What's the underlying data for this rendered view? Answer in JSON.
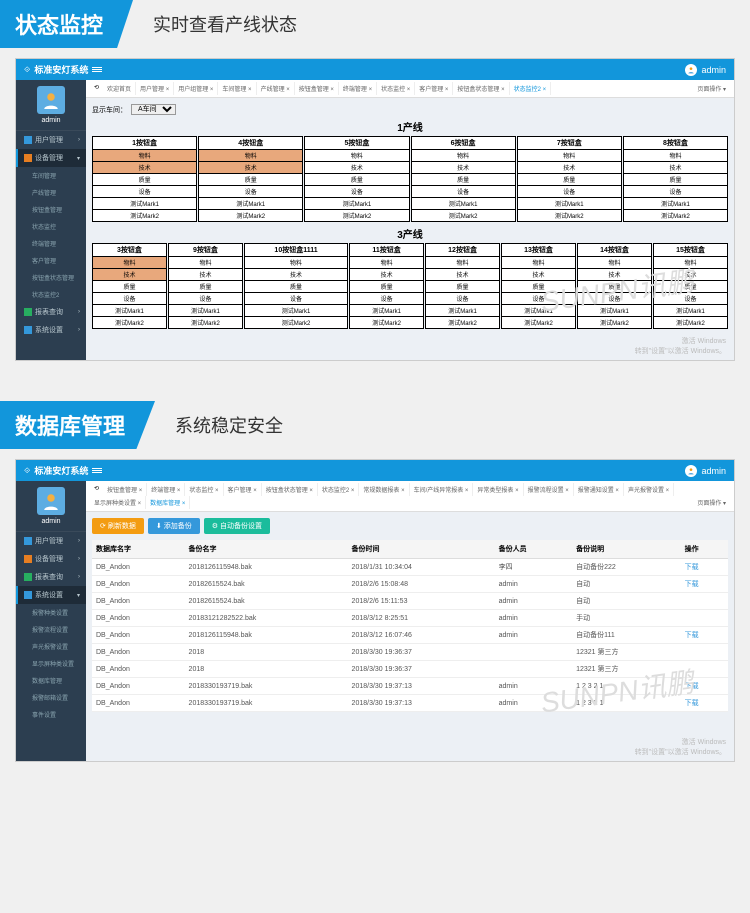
{
  "section1": {
    "banner": "状态监控",
    "subtitle": "实时查看产线状态"
  },
  "section2": {
    "banner": "数据库管理",
    "subtitle": "系统稳定安全"
  },
  "app": {
    "title": "标准安灯系统",
    "user": "admin",
    "admin_label": "admin"
  },
  "nav1": {
    "user_mgmt": "用户管理",
    "dev_mgmt": "设备管理",
    "workshop": "车间管理",
    "line": "产线管理",
    "button": "按钮盒管理",
    "status": "状态监控",
    "remote": "终端管理",
    "client": "客户管理",
    "btn_status": "按钮盒状态管理",
    "status2": "状态监控2",
    "report": "报表查询",
    "sys": "系统设置"
  },
  "nav2": {
    "user_mgmt": "用户管理",
    "dev_mgmt": "设备管理",
    "report": "报表查询",
    "sys": "系统设置",
    "s1": "报警种类设置",
    "s2": "报警流程设置",
    "s3": "声光报警设置",
    "s4": "显示屏种类设置",
    "s5": "数据库管理",
    "s6": "报警邮箱设置",
    "s7": "事件设置"
  },
  "tabs1": [
    "欢迎首页",
    "用户管理 ×",
    "用户组管理 ×",
    "车间管理 ×",
    "产线管理 ×",
    "按钮盒管理 ×",
    "终端管理 ×",
    "状态监控 ×",
    "客户管理 ×",
    "按钮盒状态管理 ×",
    "状态监控2 ×"
  ],
  "tabs2": [
    "按钮盒管理 ×",
    "终端管理 ×",
    "状态监控 ×",
    "客户管理 ×",
    "按钮盒状态管理 ×",
    "状态监控2 ×",
    "常规数据报表 ×",
    "车间/产线异常报表 ×",
    "异常类型报表 ×",
    "报警流程设置 ×",
    "报警通知设置 ×",
    "声光报警设置 ×",
    "显示屏种类设置 ×",
    "数据库管理 ×"
  ],
  "tab_ops": "页面操作 ▾",
  "filter_label": "显示车间：",
  "filter_value": "A车间",
  "line1_title": "1产线",
  "line3_title": "3产线",
  "grid1_headers": [
    "1按钮盒",
    "4按钮盒",
    "5按钮盒",
    "6按钮盒",
    "7按钮盒",
    "8按钮盒"
  ],
  "grid3_headers": [
    "3按钮盒",
    "9按钮盒",
    "10按钮盒1111",
    "11按钮盒",
    "12按钮盒",
    "13按钮盒",
    "14按钮盒",
    "15按钮盒"
  ],
  "grid_rows": [
    "物料",
    "技术",
    "质量",
    "设备",
    "测试Mark1",
    "测试Mark2"
  ],
  "btns": {
    "refresh": "刷新数据",
    "add": "添加备份",
    "auto": "自动备份设置"
  },
  "table": {
    "headers": [
      "数据库名字",
      "备份名字",
      "备份时间",
      "备份人员",
      "备份说明",
      "操作"
    ],
    "rows": [
      [
        "DB_Andon",
        "2018126115948.bak",
        "2018/1/31 10:34:04",
        "李四",
        "自动备份222",
        "下载"
      ],
      [
        "DB_Andon",
        "20182615524.bak",
        "2018/2/6 15:08:48",
        "admin",
        "自动",
        "下载"
      ],
      [
        "DB_Andon",
        "20182615524.bak",
        "2018/2/6 15:11:53",
        "admin",
        "自动",
        ""
      ],
      [
        "DB_Andon",
        "20183121282522.bak",
        "2018/3/12 8:25:51",
        "admin",
        "手动",
        ""
      ],
      [
        "DB_Andon",
        "2018126115948.bak",
        "2018/3/12 16:07:46",
        "admin",
        "自动备份111",
        "下载"
      ],
      [
        "DB_Andon",
        "2018",
        "2018/3/30 19:36:37",
        "",
        "12321 第三方",
        ""
      ],
      [
        "DB_Andon",
        "2018",
        "2018/3/30 19:36:37",
        "",
        "12321 第三方",
        ""
      ],
      [
        "DB_Andon",
        "2018330193719.bak",
        "2018/3/30 19:37:13",
        "admin",
        "1 2 3 2 1",
        "下载"
      ],
      [
        "DB_Andon",
        "2018330193719.bak",
        "2018/3/30 19:37:13",
        "admin",
        "1 2 3 2 1",
        "下载"
      ]
    ]
  },
  "watermark": "SUNPN讯鹏",
  "win_activate": "激活 Windows",
  "win_note": "转到\"设置\"以激活 Windows。"
}
